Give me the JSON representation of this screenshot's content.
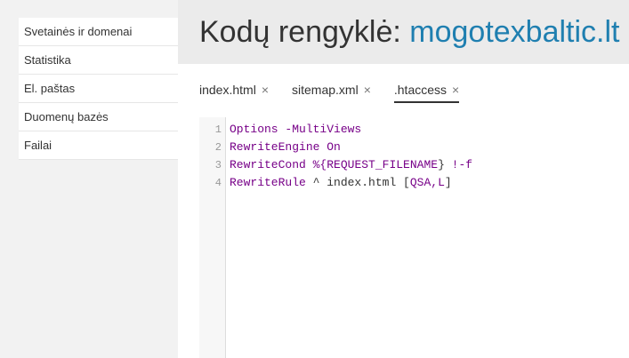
{
  "sidebar": {
    "items": [
      {
        "label": "Svetainės ir domenai"
      },
      {
        "label": "Statistika"
      },
      {
        "label": "El. paštas"
      },
      {
        "label": "Duomenų bazės"
      },
      {
        "label": "Failai"
      }
    ]
  },
  "header": {
    "title_prefix": "Kodų rengyklė: ",
    "title_domain": "mogotexbaltic.lt"
  },
  "tabs": [
    {
      "label": "index.html",
      "close": "×",
      "active": false
    },
    {
      "label": "sitemap.xml",
      "close": "×",
      "active": false
    },
    {
      "label": ".htaccess",
      "close": "×",
      "active": true
    }
  ],
  "editor": {
    "line_numbers": [
      "1",
      "2",
      "3",
      "4"
    ],
    "lines": [
      {
        "t1": "Options",
        "t2": " -MultiViews",
        "t3": "",
        "t4": "",
        "t5": ""
      },
      {
        "t1": "RewriteEngine",
        "t2": " On",
        "t3": "",
        "t4": "",
        "t5": ""
      },
      {
        "t1": "RewriteCond",
        "t2": " %{",
        "t3": "REQUEST_FILENAME",
        "t4": "}",
        "t5": " !-f"
      },
      {
        "t1": "RewriteRule",
        "t2": " ^ index.html [",
        "t3": "QSA",
        "t4": ",L",
        "t5": "]"
      }
    ]
  },
  "colors": {
    "domain_link": "#1f7fb0",
    "keyword": "#770088"
  }
}
